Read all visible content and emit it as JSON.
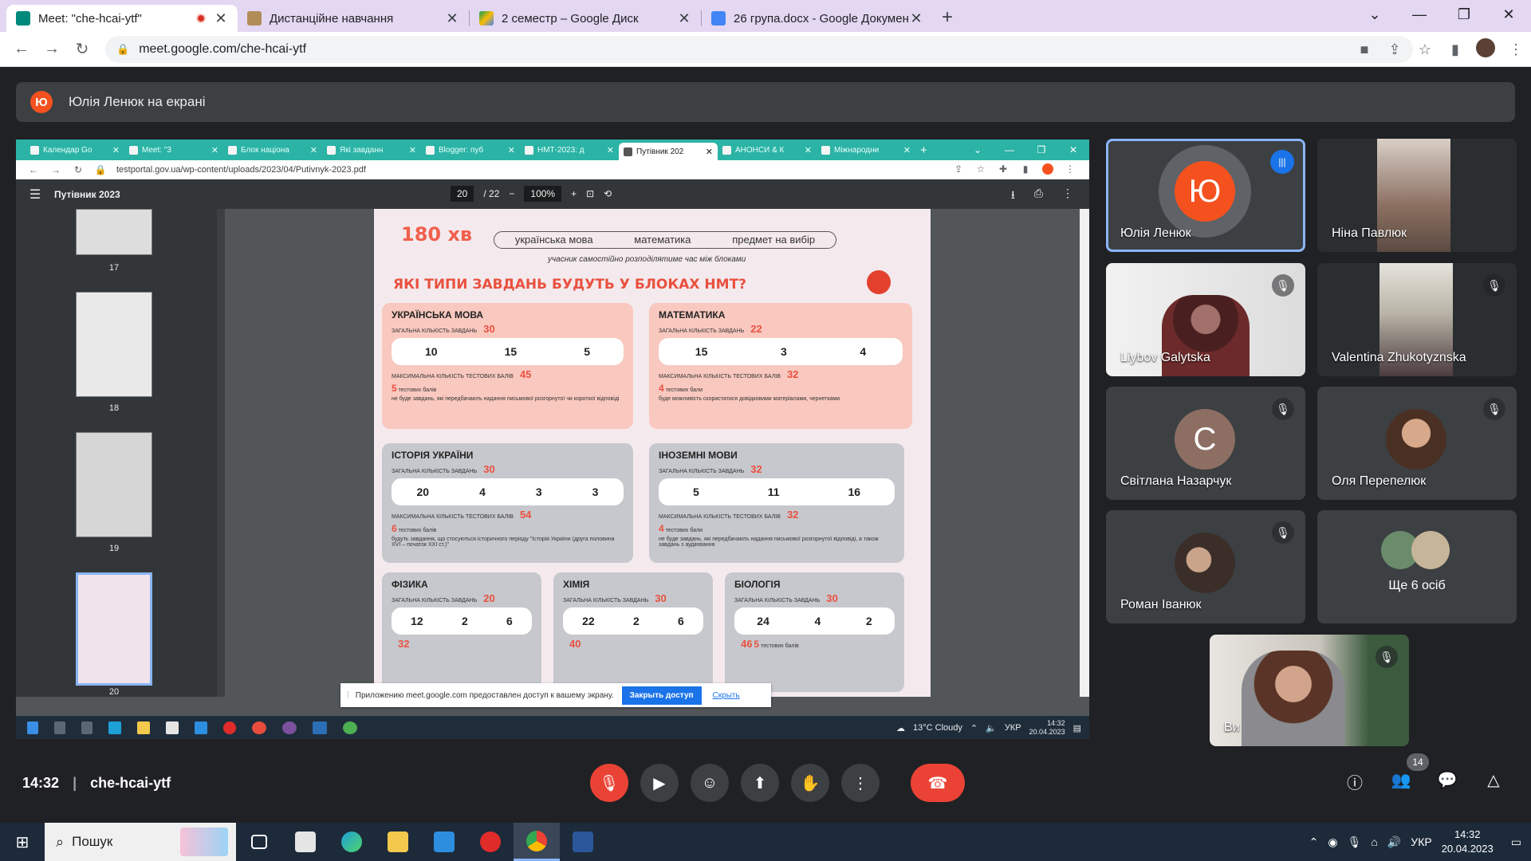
{
  "browser": {
    "tabs": [
      {
        "title": "Meet: \"che-hcai-ytf\"",
        "active": true,
        "color": "#00897b",
        "recording": true
      },
      {
        "title": "Дистанційне навчання",
        "active": false,
        "color": "#b08d57"
      },
      {
        "title": "2 семестр – Google Диск",
        "active": false,
        "color": "#fbbc04"
      },
      {
        "title": "26 група.docx - Google Докумен",
        "active": false,
        "color": "#4285f4"
      }
    ],
    "url": "meet.google.com/che-hcai-ytf"
  },
  "meet": {
    "presenting_initial": "Ю",
    "presenting_text": "Юлія Ленюк на екрані",
    "time": "14:32",
    "separator": "|",
    "code": "che-hcai-ytf",
    "participant_count": "14"
  },
  "shared": {
    "tabs": [
      "Календар Go",
      "Meet: \"3",
      "Блок націона",
      "Які завданн",
      "Blogger: пуб",
      "НМТ-2023: д",
      "Путівник 202",
      "АНОНСИ & К",
      "Міжнародни"
    ],
    "active_tab_index": 6,
    "url": "testportal.gov.ua/wp-content/uploads/2023/04/Putivnyk-2023.pdf",
    "pdf_title": "Путівник 2023",
    "page_current": "20",
    "page_total": "/ 22",
    "zoom": "100%",
    "thumbnails": [
      "17",
      "18",
      "19",
      "20"
    ],
    "page": {
      "minutes": "180 хв",
      "blocks": [
        "українська мова",
        "математика",
        "предмет на вибір"
      ],
      "note": "учасник самостійно розподілятиме час між блоками",
      "question": "ЯКІ ТИПИ ЗАВДАНЬ БУДУТЬ У БЛОКАХ НМТ?",
      "cards": [
        {
          "title": "УКРАЇНСЬКА МОВА",
          "total_label": "ЗАГАЛЬНА КІЛЬКІСТЬ ЗАВДАНЬ",
          "total": "30",
          "nums": [
            "10",
            "15",
            "5"
          ],
          "max_label": "МАКСИМАЛЬНА КІЛЬКІСТЬ ТЕСТОВИХ БАЛІВ",
          "max": "45",
          "min": "5",
          "min_label": "тестових балів",
          "note": "не буде завдань, які передбачають надання письмової розгорнутої чи короткої відповіді"
        },
        {
          "title": "МАТЕМАТИКА",
          "total_label": "ЗАГАЛЬНА КІЛЬКІСТЬ ЗАВДАНЬ",
          "total": "22",
          "nums": [
            "15",
            "3",
            "4"
          ],
          "max_label": "МАКСИМАЛЬНА КІЛЬКІСТЬ ТЕСТОВИХ БАЛІВ",
          "max": "32",
          "min": "4",
          "min_label": "тестових бали",
          "note": "буде можливість скористатися довідковими матеріалами, чернетками"
        },
        {
          "title": "ІСТОРІЯ УКРАЇНИ",
          "total_label": "ЗАГАЛЬНА КІЛЬКІСТЬ ЗАВДАНЬ",
          "total": "30",
          "nums": [
            "20",
            "4",
            "3",
            "3"
          ],
          "max_label": "МАКСИМАЛЬНА КІЛЬКІСТЬ ТЕСТОВИХ БАЛІВ",
          "max": "54",
          "min": "6",
          "min_label": "тестових балів",
          "note": "будуть завдання, що стосуються історичного періоду \"Історія України (друга половина XVI – початок XXI ст.)\""
        },
        {
          "title": "ІНОЗЕМНІ МОВИ",
          "total_label": "ЗАГАЛЬНА КІЛЬКІСТЬ ЗАВДАНЬ",
          "total": "32",
          "nums": [
            "5",
            "11",
            "16"
          ],
          "max_label": "МАКСИМАЛЬНА КІЛЬКІСТЬ ТЕСТОВИХ БАЛІВ",
          "max": "32",
          "min": "4",
          "min_label": "тестових бали",
          "note": "не буде завдань, які передбачають надання письмової розгорнутої відповіді, а також завдань з аудіювання"
        },
        {
          "title": "ФІЗИКА",
          "total_label": "ЗАГАЛЬНА КІЛЬКІСТЬ ЗАВДАНЬ",
          "total": "20",
          "nums": [
            "12",
            "2",
            "6"
          ],
          "max": "32"
        },
        {
          "title": "ХІМІЯ",
          "total_label": "ЗАГАЛЬНА КІЛЬКІСТЬ ЗАВДАНЬ",
          "total": "30",
          "nums": [
            "22",
            "2",
            "6"
          ],
          "max": "40"
        },
        {
          "title": "БІОЛОГІЯ",
          "total_label": "ЗАГАЛЬНА КІЛЬКІСТЬ ЗАВДАНЬ",
          "total": "30",
          "nums": [
            "24",
            "4",
            "2"
          ],
          "max": "46",
          "min": "5",
          "min_label": "тестових балів"
        }
      ]
    },
    "share_bar": {
      "text": "Приложению meet.google.com предоставлен доступ к вашему экрану.",
      "stop": "Закрыть доступ",
      "hide": "Скрыть"
    },
    "taskbar": {
      "weather": "13°C  Cloudy",
      "lang": "УКР",
      "time": "14:32",
      "date": "20.04.2023"
    }
  },
  "participants": [
    {
      "name": "Юлія Ленюк",
      "initial": "Ю",
      "avatar_color": "#f4511e",
      "speaking": true
    },
    {
      "name": "Ніна Павлюк"
    },
    {
      "name": "Liybov Galytska",
      "muted": true
    },
    {
      "name": "Valentina Zhukotyznska",
      "muted": true
    },
    {
      "name": "Світлана Назарчук",
      "initial": "С",
      "avatar_color": "#8d6e63",
      "muted": true
    },
    {
      "name": "Оля Перепелюк",
      "muted": true
    },
    {
      "name": "Роман Іванюк",
      "muted": true
    },
    {
      "name": "Ще 6 осіб"
    },
    {
      "name": "Ви",
      "muted": true
    }
  ],
  "windows": {
    "search": "Пошук",
    "lang": "УКР",
    "time": "14:32",
    "date": "20.04.2023"
  }
}
